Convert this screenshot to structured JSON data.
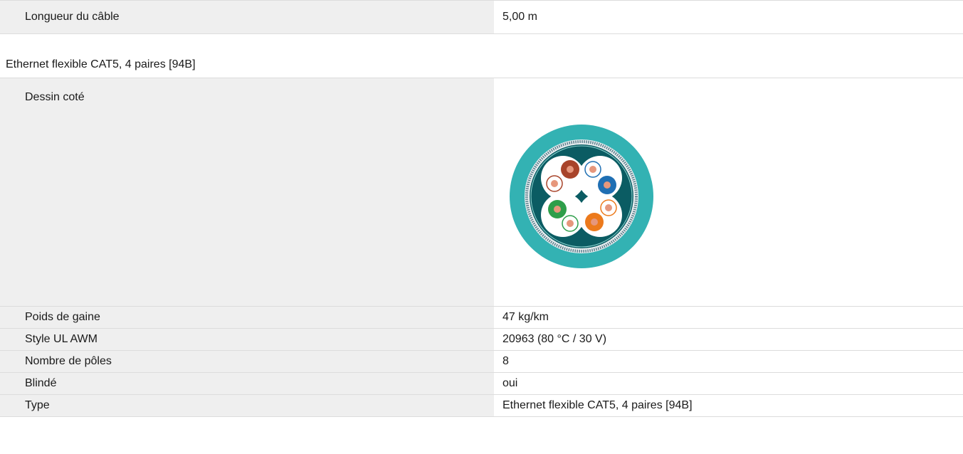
{
  "top": {
    "label": "Longueur du câble",
    "value": "5,00 m"
  },
  "section": {
    "title": "Ethernet flexible CAT5, 4 paires [94B]"
  },
  "drawing": {
    "label": "Dessin coté",
    "icon": "cable-cross-section-icon",
    "colors": {
      "jacket": "#33b2b3",
      "inner": "#0b5c63",
      "shield": "#ffffff",
      "pair_brown": "#a8442a",
      "pair_blue": "#1f6fb3",
      "pair_green": "#2e9e4a",
      "pair_orange": "#ec7a1c",
      "copper": "#e6977c"
    }
  },
  "rows": [
    {
      "label": "Poids de gaine",
      "value": "47 kg/km"
    },
    {
      "label": "Style UL AWM",
      "value": "20963 (80 °C / 30 V)"
    },
    {
      "label": "Nombre de pôles",
      "value": "8"
    },
    {
      "label": "Blindé",
      "value": "oui"
    },
    {
      "label": "Type",
      "value": "Ethernet flexible CAT5, 4 paires [94B]"
    }
  ]
}
